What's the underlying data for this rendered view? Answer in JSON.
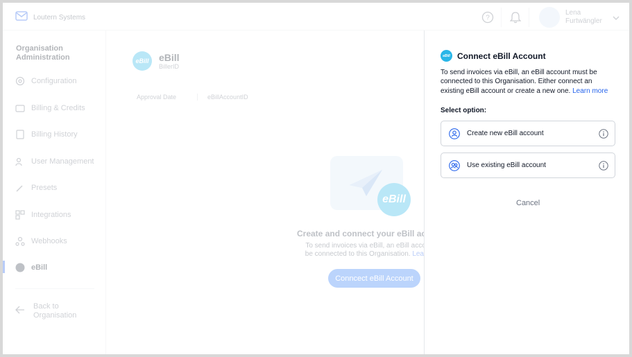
{
  "brand": {
    "name": "Loutern Systems"
  },
  "user": {
    "name": "Lena Furtwängler"
  },
  "sidebar": {
    "title": "Organisation Administration",
    "items": [
      {
        "label": "Configuration",
        "icon": "gear-icon"
      },
      {
        "label": "Billing & Credits",
        "icon": "wallet-icon"
      },
      {
        "label": "Billing History",
        "icon": "receipt-icon"
      },
      {
        "label": "User Management",
        "icon": "users-icon"
      },
      {
        "label": "Presets",
        "icon": "wand-icon"
      },
      {
        "label": "Integrations",
        "icon": "grid-icon"
      },
      {
        "label": "Webhooks",
        "icon": "webhook-icon"
      },
      {
        "label": "eBill",
        "icon": "ebill-icon"
      }
    ],
    "back_label": "Back to Organisation"
  },
  "main": {
    "logo_text": "eBill",
    "title": "eBill",
    "subtitle": "BillerID",
    "meta": [
      "Approval Date",
      "eBillAccountID"
    ],
    "hero_badge": "eBill",
    "empty_title": "Create and connect your eBill acco",
    "empty_text": "To send invoices via eBill, an eBill account",
    "empty_text2": "be connected to this Organisation.",
    "empty_link": "Learn n",
    "cta": "Conncect eBill Account"
  },
  "drawer": {
    "logo_text": "eBill",
    "title": "Connect eBill Account",
    "description": "To send invoices via eBill, an eBill account must be connected to this Organisation. Either connect an existing eBill account or create a new one.",
    "learn_more": "Learn more",
    "select_label": "Select option:",
    "options": [
      {
        "label": "Create new eBill account",
        "icon": "user-plus-icon"
      },
      {
        "label": "Use existing eBill account",
        "icon": "user-link-icon"
      }
    ],
    "cancel": "Cancel"
  },
  "colors": {
    "accent": "#2563eb",
    "ebill": "#29b6e8"
  }
}
